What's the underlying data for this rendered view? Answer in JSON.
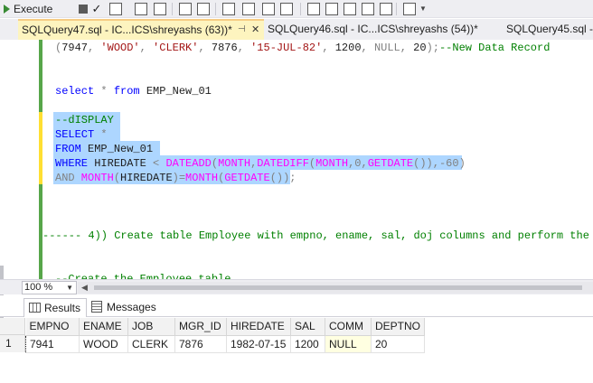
{
  "toolbar": {
    "execute_label": "Execute",
    "items": [
      "stop-icon",
      "check-icon",
      "parse-icon",
      "results-grid-icon",
      "results-file-icon",
      "comment-icon",
      "uncomment-icon",
      "indent-icon",
      "outdent-icon",
      "snippet-icon"
    ]
  },
  "tabs": [
    {
      "label": "SQLQuery47.sql - IC...ICS\\shreyashs (63))*",
      "pin": "⊣",
      "close": "✕",
      "active": true
    },
    {
      "label": "SQLQuery46.sql - IC...ICS\\shreyashs (54))*",
      "active": false
    },
    {
      "label": "SQLQuery45.sql -",
      "active": false
    }
  ],
  "editor": {
    "line1": {
      "open": "(",
      "n1": "7947",
      "s1": "'WOOD'",
      "s2": "'CLERK'",
      "n2": "7876",
      "s3": "'15-JUL-82'",
      "n3": "1200",
      "nul": "NULL",
      "n4": "20",
      "close": ");",
      "comment": "--New Data Record"
    },
    "line2": {
      "kw1": "select",
      "star": " * ",
      "kw2": "from",
      "tbl": " EMP_New_01"
    },
    "line3": {
      "comment": "--dISPLAY"
    },
    "line4": {
      "kw": "SELECT",
      "star": " *"
    },
    "line5": {
      "kw": "FROM",
      "tbl": " EMP_New_01"
    },
    "line6": {
      "kw": "WHERE",
      "col": " HIREDATE ",
      "op": "<",
      "f1": "DATEADD",
      "p1": "(",
      "a1": "MONTH",
      "c1": ",",
      "f2": "DATEDIFF",
      "p2": "(",
      "a2": "MONTH",
      "c2": ",0,",
      "f3": "GETDATE",
      "p3": "())",
      "c3": ",-60",
      "p4": ")"
    },
    "line7": {
      "kw": "AND",
      "f1": " MONTH",
      "p1": "(",
      "col": "HIREDATE",
      "p2": ")",
      "eq": "=",
      "f2": "MONTH",
      "p3": "(",
      "f3": "GETDATE",
      "p4": "());"
    },
    "line8": {
      "comment": "------ 4)) Create table Employee with empno, ename, sal, doj columns and perform the"
    },
    "line9": {
      "comment": "--Create the Employee table"
    }
  },
  "zoom": {
    "value": "100 %"
  },
  "results": {
    "tabs": [
      {
        "label": "Results",
        "active": true
      },
      {
        "label": "Messages",
        "active": false
      }
    ],
    "columns": [
      "EMPNO",
      "ENAME",
      "JOB",
      "MGR_ID",
      "HIREDATE",
      "SAL",
      "COMM",
      "DEPTNO"
    ],
    "rows": [
      {
        "num": "1",
        "cells": [
          "7941",
          "WOOD",
          "CLERK",
          "7876",
          "1982-07-15",
          "1200",
          "NULL",
          "20"
        ]
      }
    ]
  },
  "colors": {
    "selection": "#add6ff",
    "keyword": "#0000ff",
    "function": "#ff00ff",
    "string": "#a31515",
    "comment": "#008000",
    "active_tab": "#fdf4bf"
  }
}
